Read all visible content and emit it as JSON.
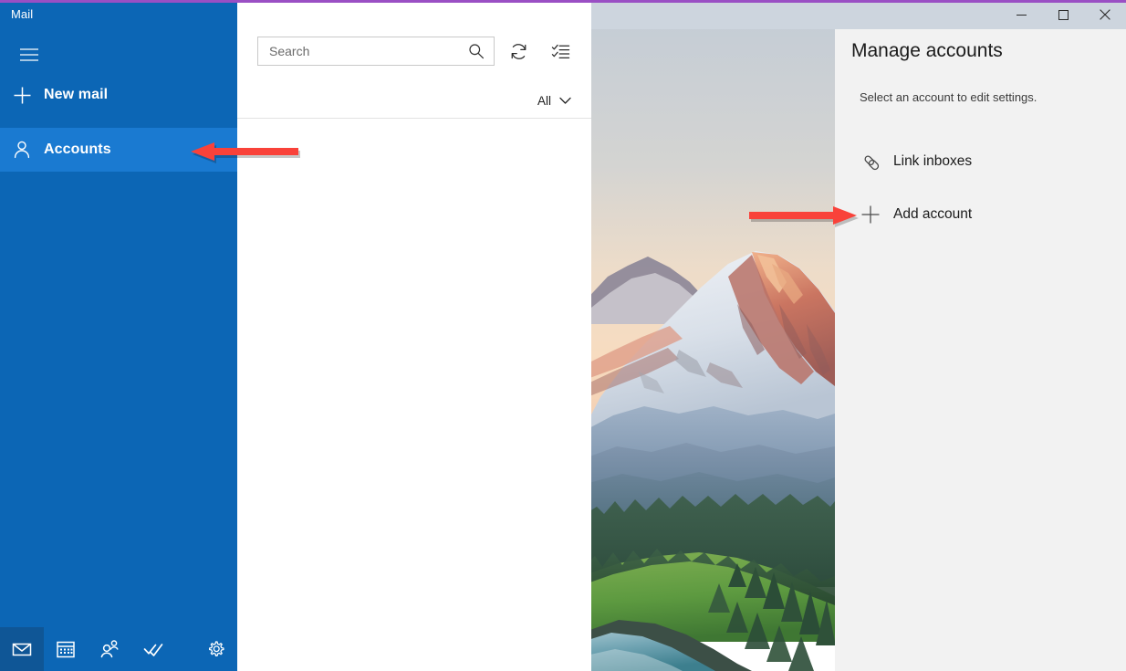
{
  "window": {
    "accent_color": "#9a4fc4",
    "titlebar_color": "#cdd5de",
    "controls": [
      {
        "name": "minimize",
        "glyph": "minimize-icon",
        "label": "Minimize"
      },
      {
        "name": "maximize",
        "glyph": "maximize-icon",
        "label": "Maximize"
      },
      {
        "name": "close",
        "glyph": "close-icon",
        "label": "Close"
      }
    ]
  },
  "sidebar": {
    "app_title": "Mail",
    "accent_color": "#0c66b5",
    "selected_color": "#1a7ad1",
    "hamburger_icon": "hamburger-icon",
    "items": [
      {
        "label": "New mail",
        "icon": "plus-icon",
        "selected": false
      },
      {
        "label": "Accounts",
        "icon": "person-icon",
        "selected": true
      }
    ],
    "appbar": [
      {
        "label": "Mail",
        "icon": "mail-icon",
        "selected": true
      },
      {
        "label": "Calendar",
        "icon": "calendar-icon",
        "selected": false
      },
      {
        "label": "People",
        "icon": "people-icon",
        "selected": false
      },
      {
        "label": "To Do",
        "icon": "todo-check-icon",
        "selected": false
      },
      {
        "label": "Settings",
        "icon": "gear-icon",
        "selected": false
      }
    ]
  },
  "list_pane": {
    "search": {
      "value": "",
      "placeholder": "Search",
      "icon": "search-icon"
    },
    "tools": [
      {
        "label": "Sync this view",
        "icon": "refresh-icon"
      },
      {
        "label": "Enter selection mode",
        "icon": "selection-mode-icon"
      }
    ],
    "filter": {
      "label": "All",
      "icon": "chevron-down-icon"
    }
  },
  "photo_pane": {
    "description": "Snow-capped mountain at sunset above forested ridges and a lake",
    "sky_top_color": "#c6cfd8",
    "sky_bottom_color": "#f6d9bf",
    "mountain_alpenglow_color": "#c96a5e",
    "snow_color": "#e9eef4",
    "haze_color": "#8fa6bd",
    "forest_color": "#2e5540",
    "lake_color": "#6f9eac"
  },
  "accounts_pane": {
    "title": "Manage accounts",
    "subtitle": "Select an account to edit settings.",
    "background_color": "#f2f2f2",
    "items": [
      {
        "label": "Link inboxes",
        "icon": "link-icon"
      },
      {
        "label": "Add account",
        "icon": "plus-icon"
      }
    ]
  },
  "annotations": {
    "color": "#f9423a",
    "arrows": [
      {
        "name": "arrow-to-accounts",
        "points_to": "Accounts",
        "direction": "left"
      },
      {
        "name": "arrow-to-add-account",
        "points_to": "Add account",
        "direction": "right"
      }
    ]
  }
}
